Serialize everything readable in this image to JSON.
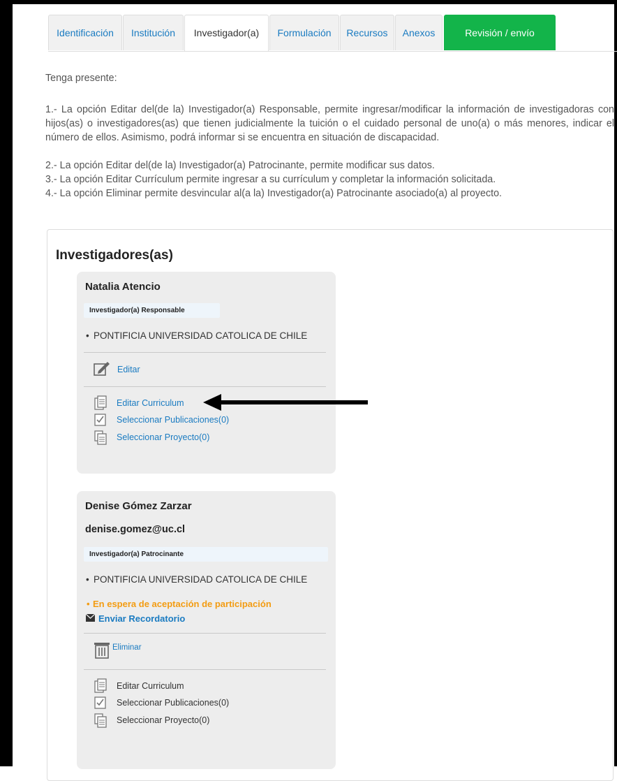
{
  "tabs": [
    {
      "label": "Identificación"
    },
    {
      "label": "Institución"
    },
    {
      "label": "Investigador(a)"
    },
    {
      "label": "Formulación"
    },
    {
      "label": "Recursos"
    },
    {
      "label": "Anexos"
    },
    {
      "label": "Revisión / envío"
    }
  ],
  "notes": {
    "heading": "Tenga presente:",
    "item1": "1.- La opción Editar del(de la) Investigador(a) Responsable, permite ingresar/modificar la información de investigadoras con hijos(as) o investigadores(as) que tienen judicialmente la tuición o el cuidado personal de uno(a) o más menores, indicar el número de ellos. Asimismo, podrá informar si se encuentra en situación de discapacidad.",
    "item2": "2.- La opción Editar del(de la) Investigador(a) Patrocinante, permite modificar sus datos.",
    "item3": "3.- La opción Editar Currículum permite ingresar a su currículum y completar la información solicitada.",
    "item4": "4.- La opción Eliminar permite desvincular al(a la) Investigador(a) Patrocinante asociado(a) al proyecto."
  },
  "panel": {
    "title": "Investigadores(as)"
  },
  "researcher1": {
    "name": "Natalia Atencio",
    "role": "Investigador(a) Responsable",
    "institution": "PONTIFICIA UNIVERSIDAD CATOLICA DE CHILE",
    "edit_label": "Editar",
    "cv_label": "Editar Curriculum",
    "pubs_label": "Seleccionar Publicaciones(0)",
    "projects_label": "Seleccionar Proyecto(0)"
  },
  "researcher2": {
    "name": "Denise Gómez Zarzar",
    "email": "denise.gomez@uc.cl",
    "role": "Investigador(a) Patrocinante",
    "institution": "PONTIFICIA UNIVERSIDAD CATOLICA DE CHILE",
    "status": "En espera de aceptación de participación",
    "reminder_label": "Enviar Recordatorio",
    "delete_label": "Eliminar",
    "cv_label": "Editar Curriculum",
    "pubs_label": "Seleccionar Publicaciones(0)",
    "projects_label": "Seleccionar Proyecto(0)"
  },
  "colors": {
    "link": "#1a7bc1",
    "accent_green": "#13b44a",
    "status_orange": "#f39c12"
  },
  "icons": [
    "edit-icon",
    "document-icon",
    "checkbox-icon",
    "stacked-pages-icon",
    "trash-icon",
    "envelope-icon",
    "arrow-pointer"
  ]
}
